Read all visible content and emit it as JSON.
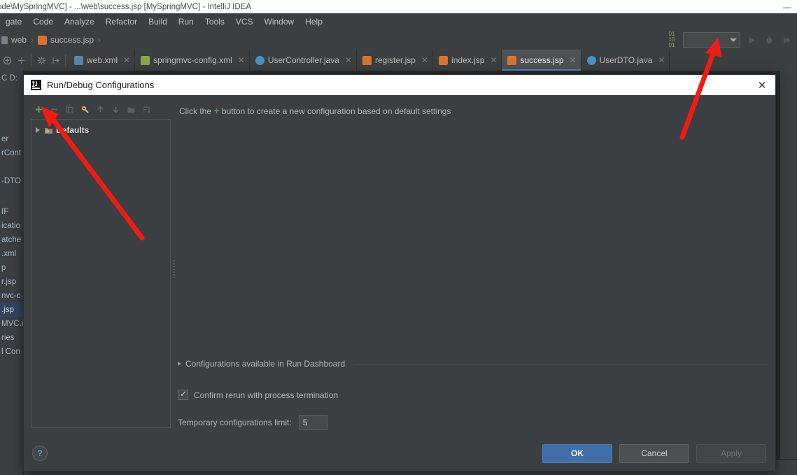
{
  "window": {
    "title": "ode\\MySpringMVC] - ...\\web\\success.jsp [MySpringMVC] - IntelliJ IDEA",
    "minimize_label": "—"
  },
  "menu": {
    "items": [
      {
        "label": "gate"
      },
      {
        "label": "Code"
      },
      {
        "label": "Analyze"
      },
      {
        "label": "Refactor"
      },
      {
        "label": "Build"
      },
      {
        "label": "Run"
      },
      {
        "label": "Tools"
      },
      {
        "label": "VCS"
      },
      {
        "label": "Window"
      },
      {
        "label": "Help"
      }
    ]
  },
  "navbar": {
    "crumbs": [
      "web",
      "success.jsp"
    ],
    "run_config_value": "",
    "icons": [
      "binary-icon",
      "run-icon",
      "debug-icon",
      "run-coverage-icon"
    ]
  },
  "editor_tabs": [
    {
      "label": "web.xml",
      "icon": "xml-file-icon",
      "active": false
    },
    {
      "label": "springmvc-config.xml",
      "icon": "spring-xml-icon",
      "active": false
    },
    {
      "label": "UserController.java",
      "icon": "java-class-icon",
      "active": false
    },
    {
      "label": "register.jsp",
      "icon": "jsp-file-icon",
      "active": false
    },
    {
      "label": "index.jsp",
      "icon": "jsp-file-icon",
      "active": false
    },
    {
      "label": "success.jsp",
      "icon": "jsp-file-icon",
      "active": true
    },
    {
      "label": "UserDTO.java",
      "icon": "java-class-icon",
      "active": false
    }
  ],
  "project_tree": {
    "header": "C  D:",
    "rows": [
      {
        "label": "er",
        "selected": false
      },
      {
        "label": "rCont",
        "selected": false
      },
      {
        "label": "-DTO",
        "selected": false
      },
      {
        "label": "IF",
        "selected": false
      },
      {
        "label": "icatio",
        "selected": false
      },
      {
        "label": "atche",
        "selected": false
      },
      {
        "label": ".xml",
        "selected": false
      },
      {
        "label": "p",
        "selected": false
      },
      {
        "label": "r.jsp",
        "selected": false
      },
      {
        "label": "nvc-c",
        "selected": false
      },
      {
        "label": ".jsp",
        "selected": true
      },
      {
        "label": "MVC.i",
        "selected": false
      },
      {
        "label": "ries",
        "selected": false
      },
      {
        "label": "l Con",
        "selected": false
      }
    ]
  },
  "dialog": {
    "title": "Run/Debug Configurations",
    "close_label": "✕",
    "toolbar": [
      {
        "name": "add-configuration",
        "glyph": "+",
        "enabled": true
      },
      {
        "name": "remove-configuration",
        "glyph": "−",
        "enabled": false
      },
      {
        "name": "copy-configuration",
        "glyph": "copy",
        "enabled": false
      },
      {
        "name": "edit-templates",
        "glyph": "wrench",
        "enabled": true
      },
      {
        "name": "move-up",
        "glyph": "↑",
        "enabled": false
      },
      {
        "name": "move-down",
        "glyph": "↓",
        "enabled": false
      },
      {
        "name": "new-folder",
        "glyph": "folder",
        "enabled": false
      },
      {
        "name": "sort-configurations",
        "glyph": "sort",
        "enabled": false
      }
    ],
    "tree": {
      "nodes": [
        {
          "label": "Defaults",
          "expanded": false
        }
      ]
    },
    "hint": {
      "before": "Click the",
      "plus": "+",
      "after": "button to create a new configuration based on default settings"
    },
    "run_dashboard_section": "Configurations available in Run Dashboard",
    "confirm_rerun": {
      "label": "Confirm rerun with process termination",
      "checked": true,
      "tick": "✓"
    },
    "temp_limit": {
      "label": "Temporary configurations limit:",
      "value": "5"
    },
    "help_label": "?",
    "buttons": [
      {
        "label": "OK",
        "style": "primary"
      },
      {
        "label": "Cancel",
        "style": "normal"
      },
      {
        "label": "Apply",
        "style": "disabled"
      }
    ]
  },
  "annotations": {
    "arrow_color": "#f01b12",
    "arrow_toolbar_target": "add-configuration-button",
    "arrow_runconfig_target": "run-configuration-selector"
  }
}
